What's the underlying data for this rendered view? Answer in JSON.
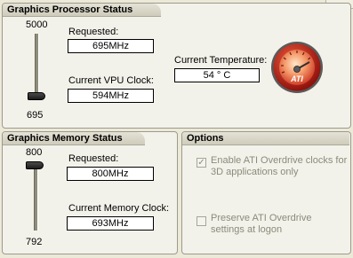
{
  "gpu_status": {
    "title": "Graphics Processor Status",
    "slider_max": "5000",
    "slider_min": "695",
    "slider_level_fraction": 0.0,
    "requested_label": "Requested:",
    "requested_value": "695MHz",
    "vpu_clock_label": "Current VPU Clock:",
    "vpu_clock_value": "594MHz",
    "temperature_label": "Current Temperature:",
    "temperature_value": "54 ° C",
    "gauge_logo": "ATI"
  },
  "memory_status": {
    "title": "Graphics Memory Status",
    "slider_max": "800",
    "slider_min": "792",
    "slider_level_fraction": 1.0,
    "requested_label": "Requested:",
    "requested_value": "800MHz",
    "memory_clock_label": "Current Memory Clock:",
    "memory_clock_value": "693MHz"
  },
  "options": {
    "title": "Options",
    "overdrive_label_line1": "Enable ATI Overdrive clocks for",
    "overdrive_label_line2": "3D applications only",
    "overdrive_checked": true,
    "preserve_label_line1": "Preserve ATI Overdrive",
    "preserve_label_line2": "settings at logon",
    "preserve_checked": false
  },
  "colors": {
    "panel_bg": "#f3f2ea",
    "gauge_red": "#c8261c"
  }
}
